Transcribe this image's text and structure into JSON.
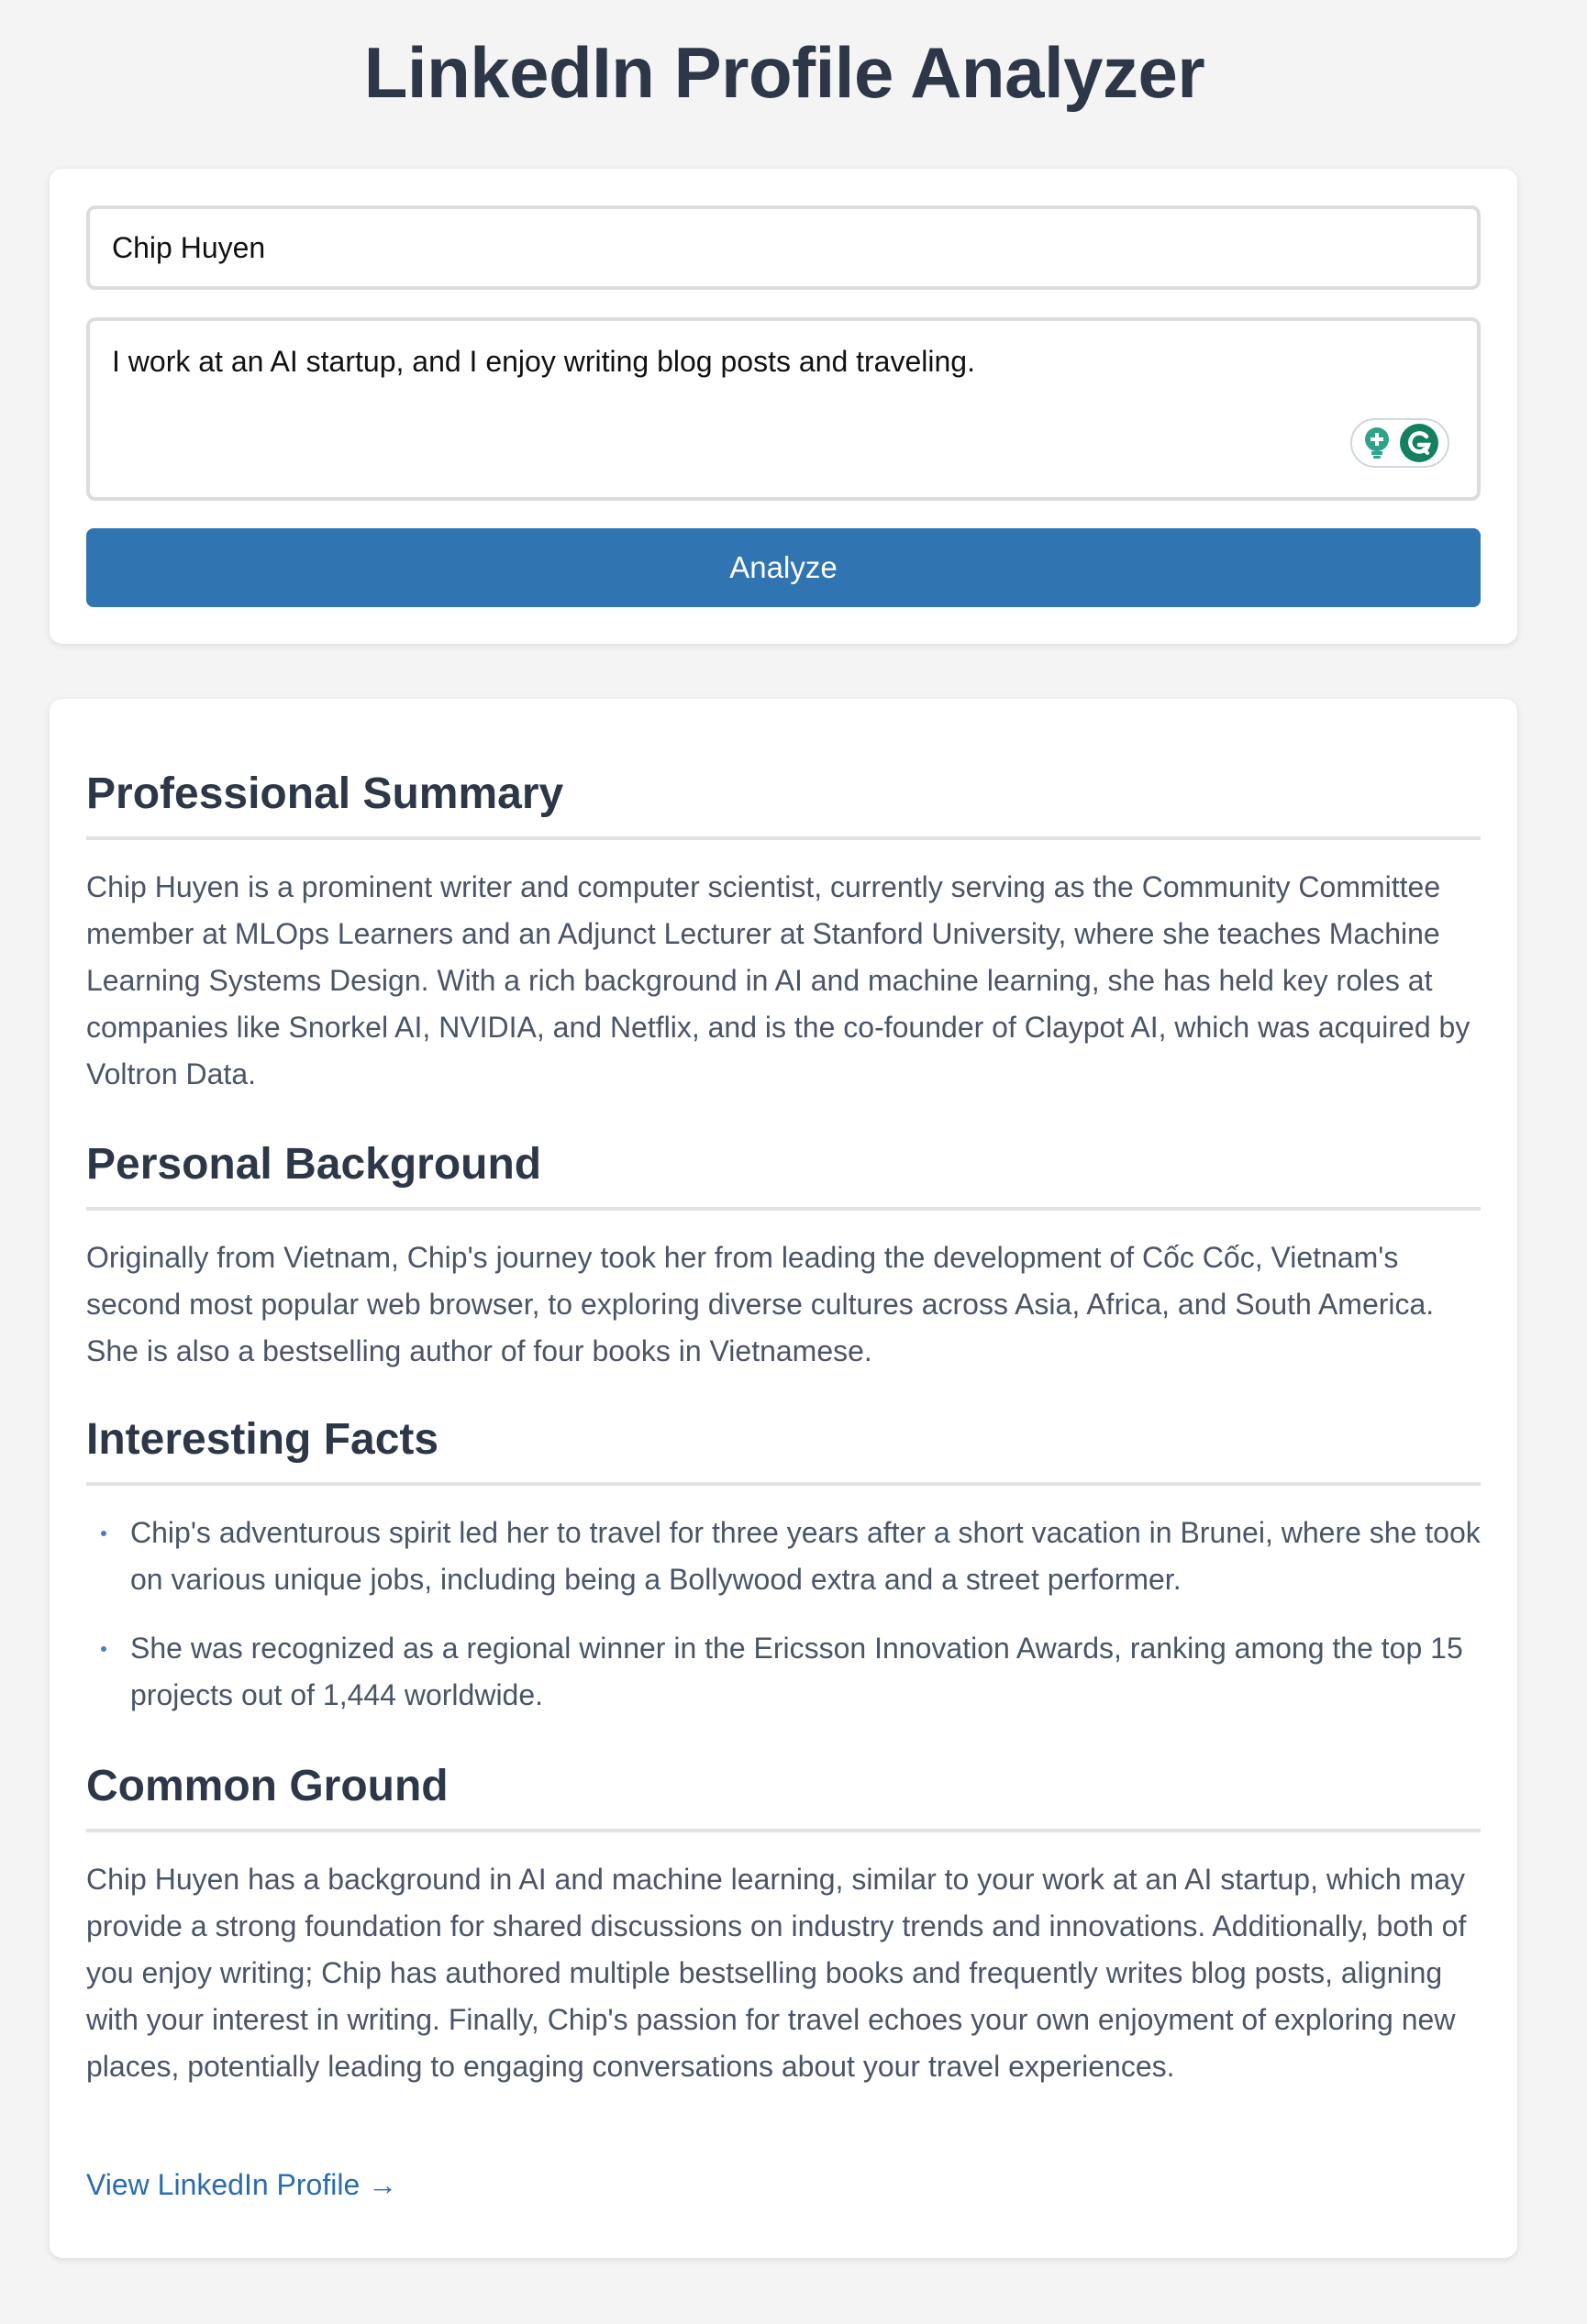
{
  "header": {
    "title": "LinkedIn Profile Analyzer"
  },
  "form": {
    "name_value": "Chip Huyen",
    "about_value": "I work at an AI startup, and I enjoy writing blog posts and traveling.",
    "analyze_label": "Analyze"
  },
  "results": {
    "professional_summary": {
      "heading": "Professional Summary",
      "text": "Chip Huyen is a prominent writer and computer scientist, currently serving as the Community Committee member at MLOps Learners and an Adjunct Lecturer at Stanford University, where she teaches Machine Learning Systems Design. With a rich background in AI and machine learning, she has held key roles at companies like Snorkel AI, NVIDIA, and Netflix, and is the co-founder of Claypot AI, which was acquired by Voltron Data."
    },
    "personal_background": {
      "heading": "Personal Background",
      "text": "Originally from Vietnam, Chip's journey took her from leading the development of Cốc Cốc, Vietnam's second most popular web browser, to exploring diverse cultures across Asia, Africa, and South America. She is also a bestselling author of four books in Vietnamese."
    },
    "interesting_facts": {
      "heading": "Interesting Facts",
      "items": [
        "Chip's adventurous spirit led her to travel for three years after a short vacation in Brunei, where she took on various unique jobs, including being a Bollywood extra and a street performer.",
        "She was recognized as a regional winner in the Ericsson Innovation Awards, ranking among the top 15 projects out of 1,444 worldwide."
      ]
    },
    "common_ground": {
      "heading": "Common Ground",
      "text": "Chip Huyen has a background in AI and machine learning, similar to your work at an AI startup, which may provide a strong foundation for shared discussions on industry trends and innovations. Additionally, both of you enjoy writing; Chip has authored multiple bestselling books and frequently writes blog posts, aligning with your interest in writing. Finally, Chip's passion for travel echoes your own enjoyment of exploring new places, potentially leading to engaging conversations about your travel experiences."
    },
    "link_label": "View LinkedIn Profile →"
  },
  "icons": {
    "grammarly_suggestion": "lightbulb-plus-icon",
    "grammarly_logo": "grammarly-g-icon"
  },
  "colors": {
    "accent": "#3174b2",
    "link": "#2b6cb0",
    "heading": "#2d3748",
    "body_text": "#4a5568",
    "background": "#f4f4f4"
  }
}
